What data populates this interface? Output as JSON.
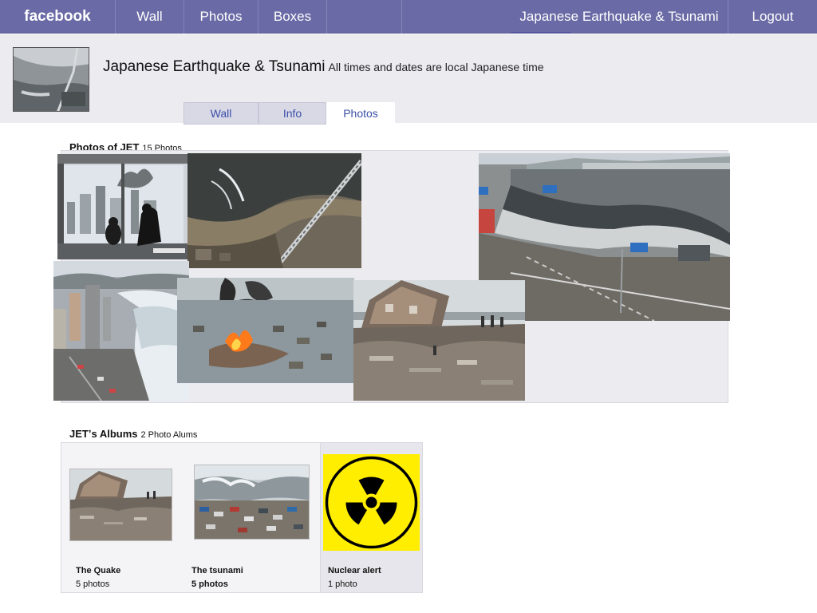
{
  "nav": {
    "logo": "facebook",
    "wall": "Wall",
    "photos": "Photos",
    "boxes": "Boxes",
    "page_name": "Japanese Earthquake & Tsunami",
    "logout": "Logout"
  },
  "profile": {
    "name": "Japanese Earthquake & Tsunami",
    "subtitle": "All times and dates are local Japanese time"
  },
  "tabs": [
    {
      "label": "Wall"
    },
    {
      "label": "Info"
    },
    {
      "label": "Photos"
    }
  ],
  "photos": {
    "title": "Photos of JET",
    "count": "15 Photos"
  },
  "albums": {
    "title": "JETʼs Albums",
    "count": "2 Photo Alums",
    "items": [
      {
        "name": "The Quake",
        "count": "5 photos"
      },
      {
        "name": "The tsunami",
        "count": "5 photos"
      },
      {
        "name": "Nuclear alert",
        "count": "1 photo"
      }
    ]
  },
  "colors": {
    "topbar": "#6a6aa6",
    "link": "#3b4fa8",
    "hazard_yellow": "#ffee00"
  }
}
